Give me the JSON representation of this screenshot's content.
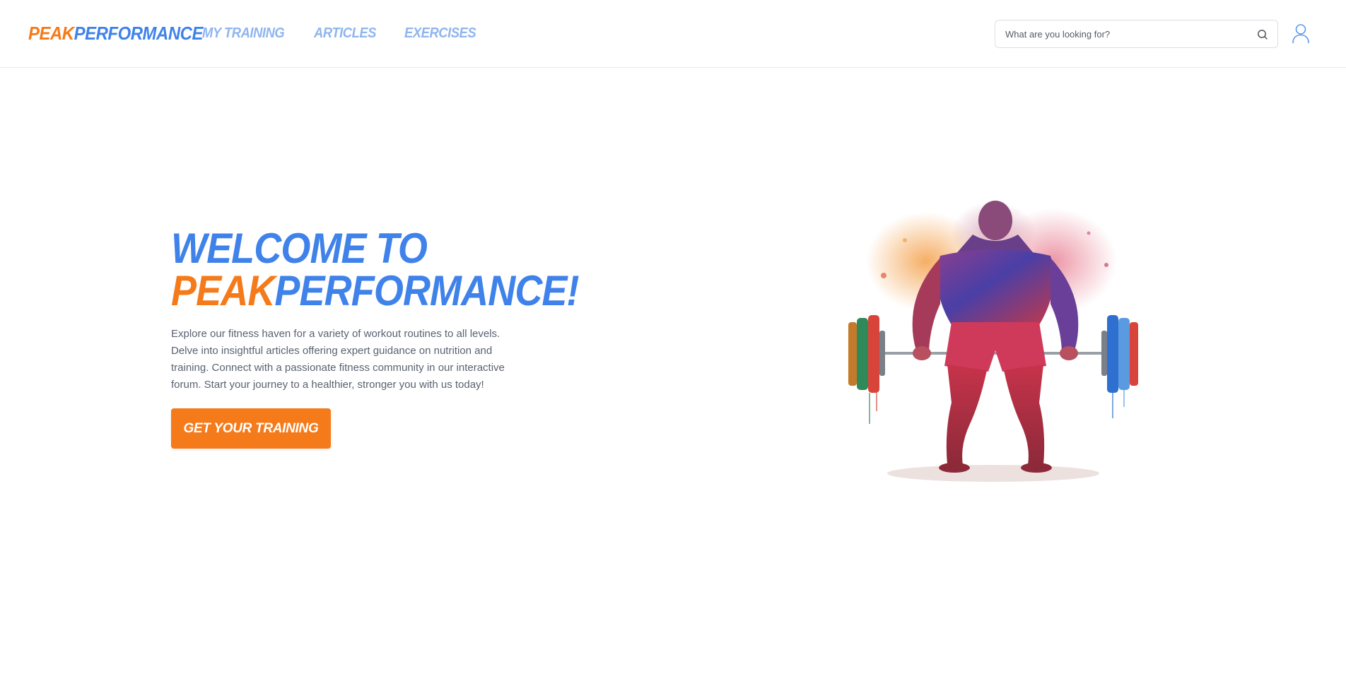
{
  "brand": {
    "peak": "PEAK",
    "performance": "PERFORMANCE",
    "colors": {
      "orange": "#f57a1a",
      "blue": "#3f82ea",
      "nav_blue": "#8fb5f0"
    }
  },
  "nav": {
    "items": [
      {
        "label": "MY TRAINING"
      },
      {
        "label": "ARTICLES"
      },
      {
        "label": "EXERCISES"
      }
    ]
  },
  "search": {
    "placeholder": "What are you looking for?",
    "value": "",
    "icon": "search-icon"
  },
  "user": {
    "icon": "user-icon"
  },
  "hero": {
    "title_line1": "WELCOME TO",
    "title_peak": "PEAK",
    "title_performance": "PERFORMANCE!",
    "description": "Explore our fitness haven for a variety of workout routines to all levels. Delve into insightful articles offering expert guidance on nutrition and training. Connect with a passionate fitness community in our interactive forum. Start your journey to a healthier, stronger you with us today!",
    "cta_label": "GET YOUR TRAINING",
    "image": "watercolor-weightlifter-illustration"
  }
}
